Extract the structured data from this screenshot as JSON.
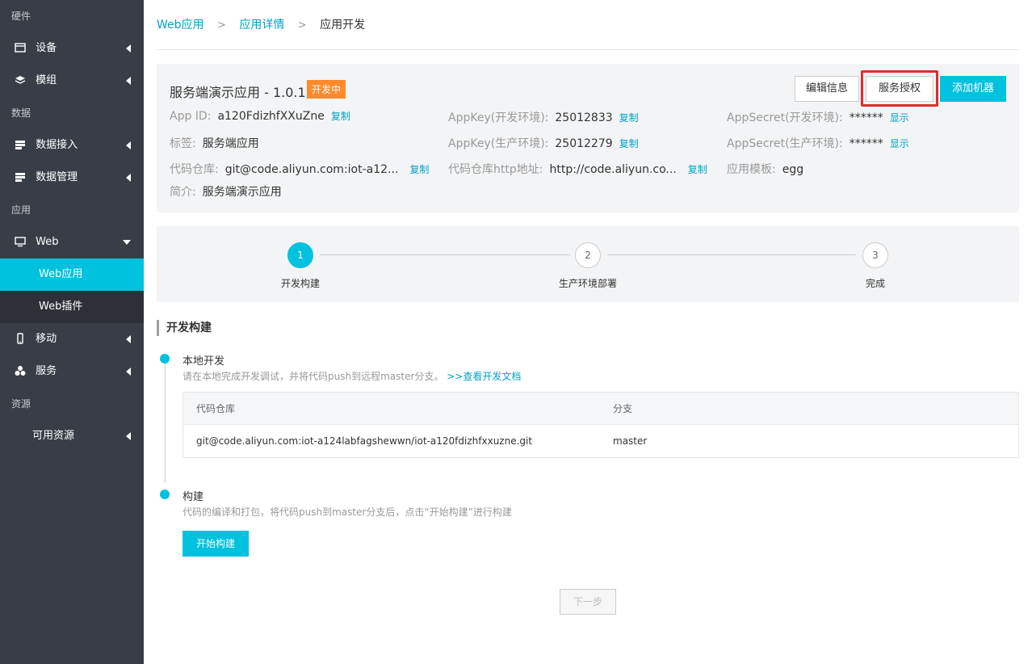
{
  "sidebar": {
    "sections": {
      "hardware": "硬件",
      "data": "数据",
      "app": "应用",
      "resources": "资源"
    },
    "items": {
      "device": "设备",
      "module": "模组",
      "data_access": "数据接入",
      "data_manage": "数据管理",
      "web": "Web",
      "web_app": "Web应用",
      "web_plugin": "Web插件",
      "mobile": "移动",
      "service": "服务",
      "available_resources": "可用资源"
    }
  },
  "breadcrumb": {
    "level1": "Web应用",
    "level2": "应用详情",
    "current": "应用开发",
    "separator": ">"
  },
  "app": {
    "title": "服务端演示应用 - 1.0.1",
    "status": "开发中",
    "buttons": {
      "edit": "编辑信息",
      "auth": "服务授权",
      "add_machine": "添加机器"
    },
    "fields": {
      "app_id_label": "App ID:",
      "app_id": "a120FdizhfXXuZne",
      "tag_label": "标签:",
      "tag": "服务端应用",
      "repo_label": "代码仓库:",
      "repo": "git@code.aliyun.com:iot-a12...",
      "desc_label": "简介:",
      "desc": "服务端演示应用",
      "appkey_dev_label": "AppKey(开发环境):",
      "appkey_dev": "25012833",
      "appkey_prod_label": "AppKey(生产环境):",
      "appkey_prod": "25012279",
      "repo_http_label": "代码仓库http地址:",
      "repo_http": "http://code.aliyun.co...",
      "secret_dev_label": "AppSecret(开发环境):",
      "secret_dev": "******",
      "secret_prod_label": "AppSecret(生产环境):",
      "secret_prod": "******",
      "template_label": "应用模板:",
      "template": "egg",
      "copy": "复制",
      "show": "显示"
    }
  },
  "steps": [
    {
      "num": "1",
      "label": "开发构建"
    },
    {
      "num": "2",
      "label": "生产环境部署"
    },
    {
      "num": "3",
      "label": "完成"
    }
  ],
  "section_title": "开发构建",
  "local_dev": {
    "title": "本地开发",
    "desc": "请在本地完成开发调试，并将代码push到远程master分支。",
    "doc_link": ">>查看开发文档"
  },
  "repo_table": {
    "col_repo": "代码仓库",
    "col_branch": "分支",
    "repo": "git@code.aliyun.com:iot-a124labfagshewwn/iot-a120fdizhfxxuzne.git",
    "branch": "master"
  },
  "build": {
    "title": "构建",
    "desc": "代码的编译和打包，将代码push到master分支后，点击“开始构建”进行构建",
    "button": "开始构建"
  },
  "next_button": "下一步",
  "colors": {
    "accent": "#00c1de",
    "sidebar": "#393e46",
    "badge": "#ff8a2b",
    "highlight": "#e02c2c"
  }
}
